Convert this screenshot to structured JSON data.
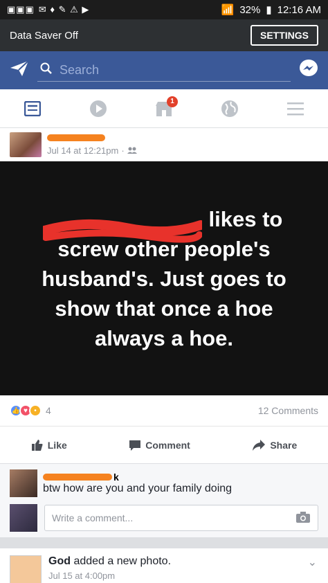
{
  "status_bar": {
    "battery": "32%",
    "time": "12:16 AM"
  },
  "data_saver": {
    "label": "Data Saver Off",
    "settings_label": "SETTINGS"
  },
  "top_bar": {
    "search_placeholder": "Search",
    "brand_color": "#3b5998"
  },
  "tabs": {
    "marketplace_badge": "1"
  },
  "post": {
    "meta_time": "Jul 14 at 12:21pm",
    "meta_separator": "·",
    "image_text_visible": "likes to screw other people's husband's. Just goes to show that once a hoe always a hoe.",
    "line1": "likes to",
    "line2": "screw other people's",
    "line3": "husband's. Just goes to",
    "line4": "show that once a hoe",
    "line5": "always a hoe.",
    "reaction_count": "4",
    "comments_count": "12 Comments",
    "like_label": "Like",
    "comment_label": "Comment",
    "share_label": "Share"
  },
  "comment": {
    "name_suffix": "k",
    "text": "btw how are you and your family doing",
    "write_placeholder": "Write a comment..."
  },
  "next_post": {
    "author": "God",
    "action": "added a new photo.",
    "meta_partial": "Jul 15 at 4:00pm"
  }
}
